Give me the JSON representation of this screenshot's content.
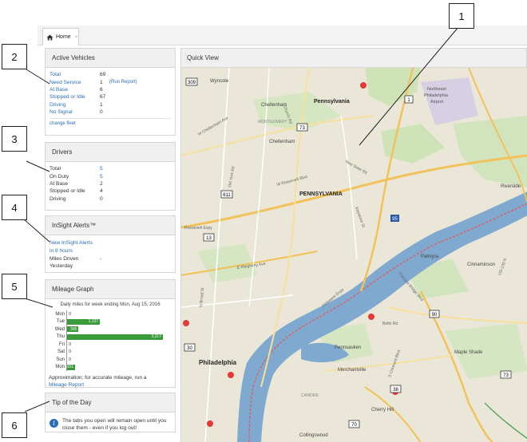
{
  "tab": {
    "label": "Home",
    "close": "×"
  },
  "active_vehicles": {
    "title": "Active Vehicles",
    "rows": [
      {
        "label": "Total",
        "value": "69"
      },
      {
        "label": "Need Service",
        "value": "1",
        "extra": "(Run Report)"
      },
      {
        "label": "At Base",
        "value": "6"
      },
      {
        "label": "Stopped or Idle",
        "value": "67"
      },
      {
        "label": "Driving",
        "value": "1"
      },
      {
        "label": "No Signal",
        "value": "0"
      }
    ],
    "change_fleet": "change fleet"
  },
  "drivers": {
    "title": "Drivers",
    "rows": [
      {
        "label": "Total",
        "value": "5"
      },
      {
        "label": "On Duty",
        "value": "5"
      },
      {
        "label": "At Base",
        "value": "2"
      },
      {
        "label": "Stopped or Idle",
        "value": "4"
      },
      {
        "label": "Driving",
        "value": "0"
      }
    ]
  },
  "insight": {
    "title": "InSight Alerts™",
    "alerts_line1": "New InSight Alerts",
    "alerts_line2": "in 8 hours",
    "miles_label1": "Miles Driven",
    "miles_label2": "Yesterday",
    "miles_value": "-"
  },
  "mileage": {
    "title": "Mileage Graph",
    "subtitle": "Daily miles for week ending Mon, Aug 15, 2016",
    "note_text": "Approximation; for accurate mileage, run a",
    "note_link": "Mileage Report"
  },
  "chart_data": {
    "type": "bar",
    "orientation": "horizontal",
    "title": "Daily miles for week ending Mon, Aug 15, 2016",
    "categories": [
      "Mon",
      "Tue",
      "Wed",
      "Thu",
      "Fri",
      "Sat",
      "Sun",
      "Mon"
    ],
    "values": [
      0,
      1137,
      395,
      3317,
      0,
      0,
      0,
      161
    ],
    "labels": [
      "0",
      "1,137",
      "395",
      "3,317",
      "0",
      "0",
      "0",
      "161"
    ],
    "max": 3317,
    "color": "#3a9b3a"
  },
  "tip": {
    "title": "Tip of the Day",
    "text": "The tabs you open will remain open until you close them - even if you log out!"
  },
  "quick_view": {
    "title": "Quick View"
  },
  "map": {
    "labels": {
      "wyncote": "Wyncote",
      "cheltenham1": "Cheltenham",
      "montgomery": "MONTGOMERY",
      "cheltenham2": "Cheltenham",
      "pa1": "Pennsylvania",
      "pa2": "PENNSYLVANIA",
      "airport": "Northeast Philadelphia Airport",
      "airport1": "Northeast",
      "airport2": "Philadelphia",
      "airport3": "Airport",
      "riverside": "Riverside",
      "palmyra": "Palmyra",
      "cinnaminson": "Cinnaminson",
      "philadelphia": "Philadelphia",
      "pennsauken": "Pennsauken",
      "merchantville": "Merchantville",
      "maple_shade": "Maple Shade",
      "camden": "CAMDEN",
      "cherry_hill": "Cherry Hill",
      "collingswood": "Collingswood",
      "roosevelt": "W Roosevelt Blvd",
      "roosevelt2": "Roosevelt Expy",
      "allegheny": "E Allegheny Ave",
      "new_state": "New State Rd",
      "delaware": "Delaware Expy",
      "broad": "N Broad St",
      "cheltenham_ave": "W Cheltenham Ave",
      "church_rd": "Church Rd",
      "old_york": "Old York Rd",
      "keystone": "Keystone St",
      "pennsauken_ave": "Palmyra Bridge Blvd",
      "crescent": "S Crescent Blvd",
      "bettons": "Betts Rd",
      "us130": "US-130 N"
    },
    "shields": [
      "309",
      "73",
      "1",
      "611",
      "13",
      "95",
      "90",
      "30",
      "38",
      "70",
      "73"
    ],
    "markers_color": "#e53935"
  },
  "callouts": [
    "1",
    "2",
    "3",
    "4",
    "5",
    "6"
  ]
}
